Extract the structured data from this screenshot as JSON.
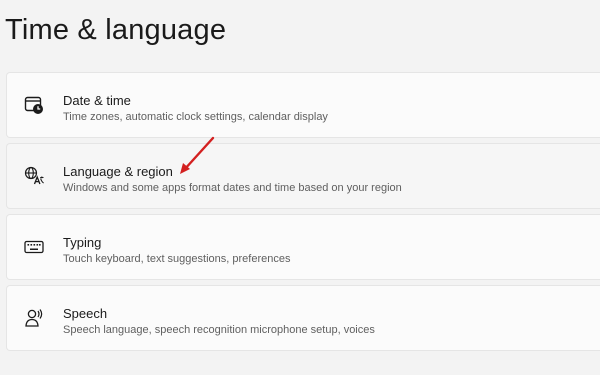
{
  "page": {
    "title": "Time & language"
  },
  "items": [
    {
      "label": "Date & time",
      "description": "Time zones, automatic clock settings, calendar display",
      "icon": "calendar-clock-icon"
    },
    {
      "label": "Language & region",
      "description": "Windows and some apps format dates and time based on your region",
      "icon": "language-globe-icon"
    },
    {
      "label": "Typing",
      "description": "Touch keyboard, text suggestions, preferences",
      "icon": "keyboard-icon"
    },
    {
      "label": "Speech",
      "description": "Speech language, speech recognition microphone setup, voices",
      "icon": "speech-person-icon"
    }
  ],
  "annotation": {
    "arrow_color": "#d32020"
  }
}
